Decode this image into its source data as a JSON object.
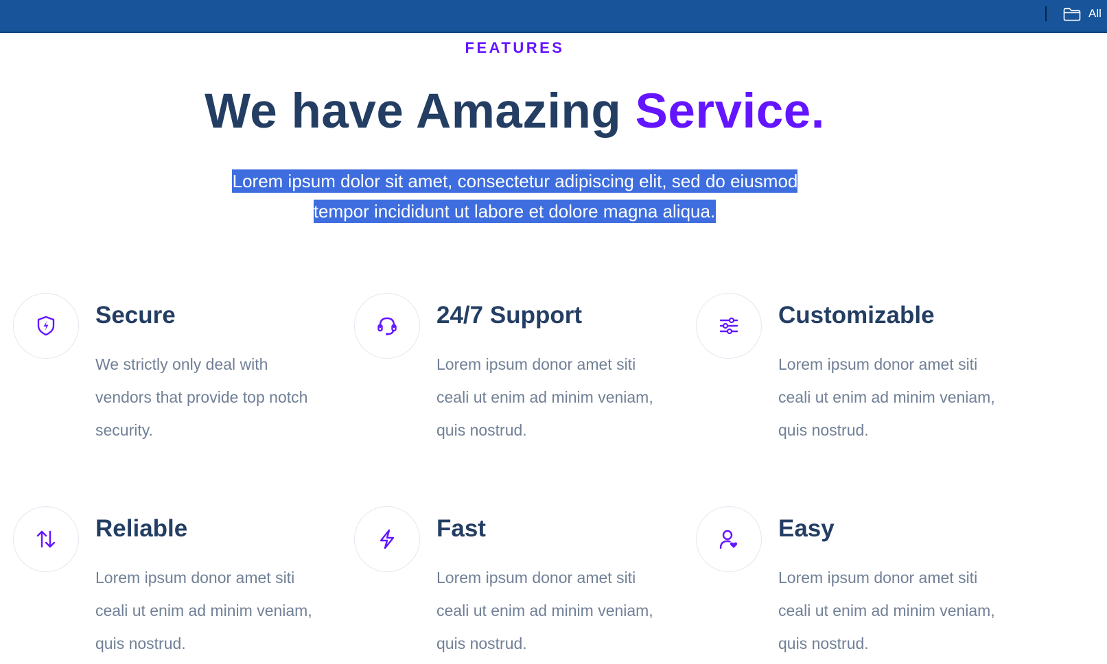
{
  "topbar": {
    "background": "#17549a",
    "folder_icon": "folder-icon",
    "all_label": "All"
  },
  "section": {
    "eyebrow": "FEATURES",
    "headline_main": "We have Amazing ",
    "headline_accent": "Service.",
    "accent_color": "#6415ff",
    "heading_color": "#243e63",
    "description": "Lorem ipsum dolor sit amet, consectetur adipiscing elit, sed do eiusmod tempor incididunt ut labore et dolore magna aliqua.",
    "description_selected": true
  },
  "features": [
    {
      "icon": "shield-bolt-icon",
      "title": "Secure",
      "description": "We strictly only deal with vendors that provide top notch security."
    },
    {
      "icon": "headset-icon",
      "title": "24/7 Support",
      "description": "Lorem ipsum donor amet siti ceali ut enim ad minim veniam, quis nostrud."
    },
    {
      "icon": "sliders-icon",
      "title": "Customizable",
      "description": "Lorem ipsum donor amet siti ceali ut enim ad minim veniam, quis nostrud."
    },
    {
      "icon": "arrows-up-down-icon",
      "title": "Reliable",
      "description": "Lorem ipsum donor amet siti ceali ut enim ad minim veniam, quis nostrud."
    },
    {
      "icon": "lightning-icon",
      "title": "Fast",
      "description": "Lorem ipsum donor amet siti ceali ut enim ad minim veniam, quis nostrud."
    },
    {
      "icon": "user-heart-icon",
      "title": "Easy",
      "description": "Lorem ipsum donor amet siti ceali ut enim ad minim veniam, quis nostrud."
    }
  ]
}
